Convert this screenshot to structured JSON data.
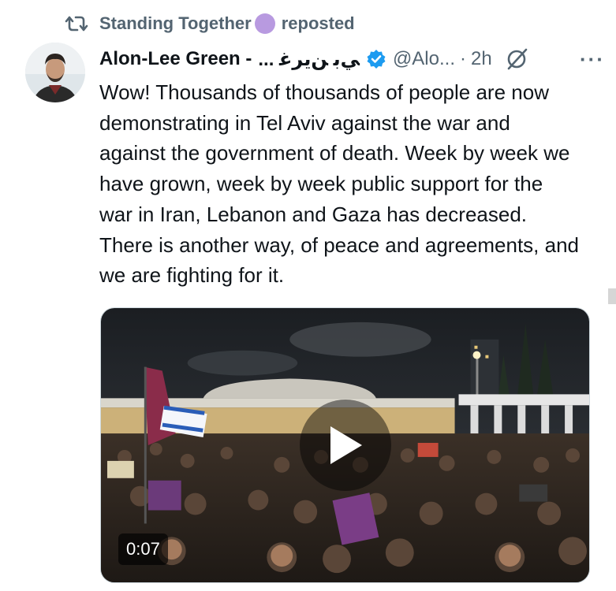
{
  "repost": {
    "icon": "repost-icon",
    "name": "Standing Together",
    "label": "reposted",
    "dot_color": "#b89ae0"
  },
  "author": {
    "name": "Alon-Lee Green -",
    "arabic_name": "... ﻲﺑ ﻦﻳﺮﻏ",
    "verified_icon": "verified-badge-icon",
    "handle": "@Alo...",
    "separator": "·",
    "time": "2h",
    "grok_icon": "grok-icon",
    "more_icon": "more-icon",
    "more_label": "···"
  },
  "tweet": {
    "text": "Wow! Thousands of thousands of people are now demonstrating in Tel Aviv against the war and against the government of death. Week by week we have grown, week by week public support for the war in Iran, Lebanon and Gaza has decreased. There is another way, of peace and agreements, and we are fighting for it."
  },
  "media": {
    "duration": "0:07",
    "play_icon": "play-icon",
    "accent": "#1d9bf0"
  }
}
